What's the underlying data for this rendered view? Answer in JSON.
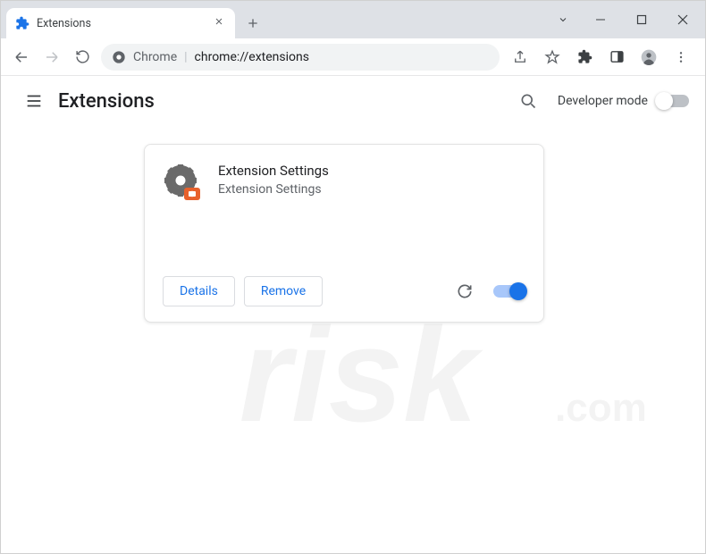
{
  "window": {
    "tab_title": "Extensions",
    "omnibox": {
      "product": "Chrome",
      "url": "chrome://extensions"
    }
  },
  "header": {
    "title": "Extensions",
    "developer_mode_label": "Developer mode",
    "developer_mode_on": false
  },
  "extension": {
    "name": "Extension Settings",
    "description": "Extension Settings",
    "details_label": "Details",
    "remove_label": "Remove",
    "enabled": true
  },
  "colors": {
    "accent": "#1a73e8",
    "text": "#202124",
    "muted": "#5f6368",
    "tabstrip": "#dee1e6",
    "omnibg": "#f1f3f4"
  }
}
